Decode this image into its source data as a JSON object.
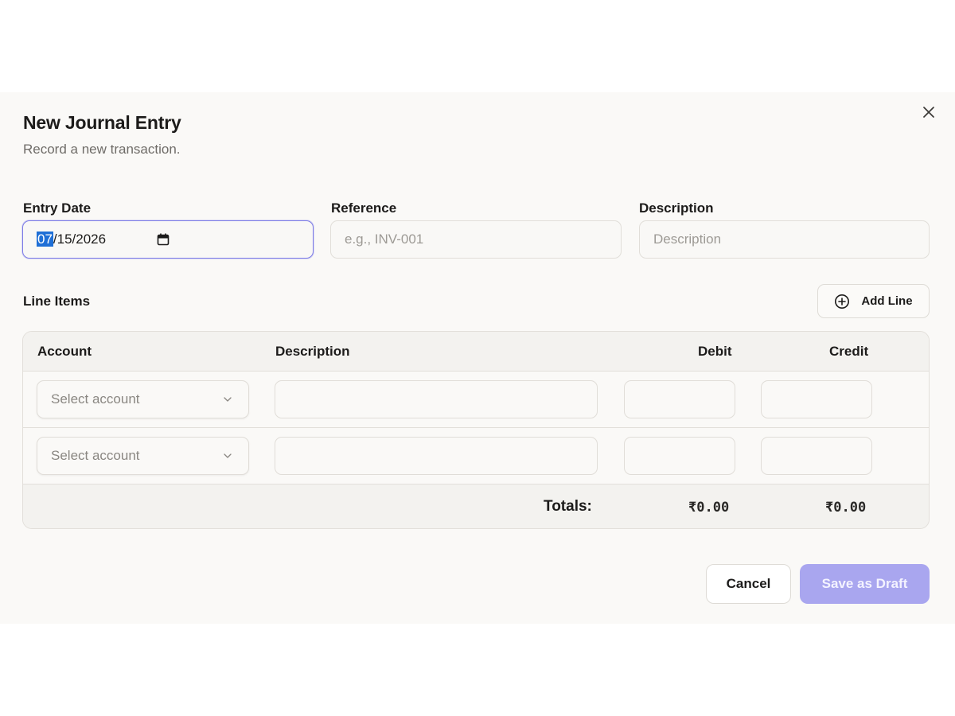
{
  "dialog": {
    "title": "New Journal Entry",
    "subtitle": "Record a new transaction.",
    "close_icon": "close-icon"
  },
  "fields": {
    "entry_date": {
      "label": "Entry Date",
      "month": "07",
      "rest": "/15/2026",
      "value": "07/15/2026",
      "icon": "calendar-icon"
    },
    "reference": {
      "label": "Reference",
      "placeholder": "e.g., INV-001",
      "value": ""
    },
    "description": {
      "label": "Description",
      "placeholder": "Description",
      "value": ""
    }
  },
  "line_items": {
    "label": "Line Items",
    "add_line_label": "Add Line",
    "add_icon": "plus-circle-icon",
    "columns": [
      "Account",
      "Description",
      "Debit",
      "Credit"
    ],
    "rows": [
      {
        "account_placeholder": "Select account",
        "description": "",
        "debit": "",
        "credit": ""
      },
      {
        "account_placeholder": "Select account",
        "description": "",
        "debit": "",
        "credit": ""
      }
    ],
    "totals": {
      "label": "Totals:",
      "debit": "₹0.00",
      "credit": "₹0.00"
    }
  },
  "actions": {
    "cancel_label": "Cancel",
    "save_draft_label": "Save as Draft",
    "save_draft_enabled": false
  },
  "colors": {
    "accent": "#7c7be6",
    "primary_disabled": "#a9a6ef",
    "date_highlight": "#1f6fd6"
  }
}
